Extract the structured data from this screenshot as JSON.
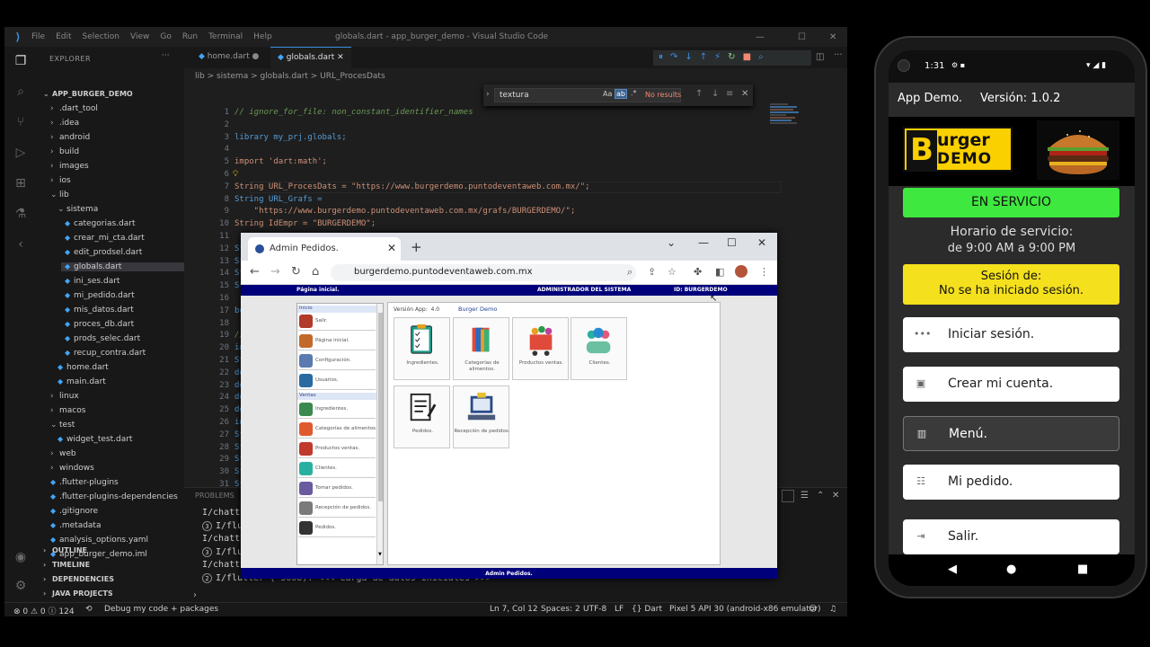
{
  "vscode": {
    "menu": [
      "File",
      "Edit",
      "Selection",
      "View",
      "Go",
      "Run",
      "Terminal",
      "Help"
    ],
    "title": "globals.dart - app_burger_demo - Visual Studio Code",
    "explorer_label": "EXPLORER",
    "tree": [
      {
        "label": "APP_BURGER_DEMO",
        "type": "root"
      },
      {
        "label": ".dart_tool",
        "type": "folder"
      },
      {
        "label": ".idea",
        "type": "folder"
      },
      {
        "label": "android",
        "type": "folder"
      },
      {
        "label": "build",
        "type": "folder"
      },
      {
        "label": "images",
        "type": "folder"
      },
      {
        "label": "ios",
        "type": "folder"
      },
      {
        "label": "lib",
        "type": "folder-open"
      },
      {
        "label": "sistema",
        "type": "folder-open"
      },
      {
        "label": "categorias.dart",
        "type": "file"
      },
      {
        "label": "crear_mi_cta.dart",
        "type": "file"
      },
      {
        "label": "edit_prodsel.dart",
        "type": "file"
      },
      {
        "label": "globals.dart",
        "type": "file"
      },
      {
        "label": "ini_ses.dart",
        "type": "file"
      },
      {
        "label": "mi_pedido.dart",
        "type": "file"
      },
      {
        "label": "mis_datos.dart",
        "type": "file"
      },
      {
        "label": "proces_db.dart",
        "type": "file"
      },
      {
        "label": "prods_selec.dart",
        "type": "file"
      },
      {
        "label": "recup_contra.dart",
        "type": "file"
      },
      {
        "label": "home.dart",
        "type": "file"
      },
      {
        "label": "main.dart",
        "type": "file"
      },
      {
        "label": "linux",
        "type": "folder"
      },
      {
        "label": "macos",
        "type": "folder"
      },
      {
        "label": "test",
        "type": "folder-open"
      },
      {
        "label": "widget_test.dart",
        "type": "file"
      },
      {
        "label": "web",
        "type": "folder"
      },
      {
        "label": "windows",
        "type": "folder"
      },
      {
        "label": ".flutter-plugins",
        "type": "file"
      },
      {
        "label": ".flutter-plugins-dependencies",
        "type": "file"
      },
      {
        "label": ".gitignore",
        "type": "file"
      },
      {
        "label": ".metadata",
        "type": "file"
      },
      {
        "label": "analysis_options.yaml",
        "type": "file"
      },
      {
        "label": "app_burger_demo.iml",
        "type": "file"
      }
    ],
    "sections": [
      "OUTLINE",
      "TIMELINE",
      "DEPENDENCIES",
      "JAVA PROJECTS"
    ],
    "tabs": [
      "home.dart",
      "globals.dart"
    ],
    "breadcrumb": "lib  >  sistema  >  globals.dart  >  URL_ProcesDats",
    "find": {
      "value": "textura",
      "aa": "Aa",
      "ab": "ab",
      "re": ".*",
      "no_results": "No results"
    },
    "code": [
      {
        "n": "1",
        "t": "// ignore_for_file: non_constant_identifier_names"
      },
      {
        "n": "2",
        "t": ""
      },
      {
        "n": "3",
        "t": "library my_prj.globals;"
      },
      {
        "n": "4",
        "t": ""
      },
      {
        "n": "5",
        "t": "import 'dart:math';"
      },
      {
        "n": "6",
        "t": ""
      },
      {
        "n": "7",
        "t": "String URL_ProcesDats = \"https://www.burgerdemo.puntodeventaweb.com.mx/\";"
      },
      {
        "n": "8",
        "t": "String URL_Grafs ="
      },
      {
        "n": "9",
        "t": "    \"https://www.burgerdemo.puntodeventaweb.com.mx/grafs/BURGERDEMO/\";"
      },
      {
        "n": "10",
        "t": "String IdEmpr = \"BURGERDEMO\";"
      },
      {
        "n": "11",
        "t": ""
      },
      {
        "n": "12",
        "t": "Str"
      },
      {
        "n": "13",
        "t": "Str"
      },
      {
        "n": "14",
        "t": "Str"
      },
      {
        "n": "15",
        "t": "Str"
      },
      {
        "n": "16",
        "t": ""
      },
      {
        "n": "17",
        "t": "boo"
      },
      {
        "n": "18",
        "t": ""
      },
      {
        "n": "19",
        "t": "//"
      },
      {
        "n": "20",
        "t": "int"
      },
      {
        "n": "21",
        "t": "Str"
      },
      {
        "n": "22",
        "t": "dou"
      },
      {
        "n": "23",
        "t": "dou"
      },
      {
        "n": "24",
        "t": "dou"
      },
      {
        "n": "25",
        "t": "dou"
      },
      {
        "n": "26",
        "t": "int"
      },
      {
        "n": "27",
        "t": "Str"
      },
      {
        "n": "28",
        "t": "Str"
      },
      {
        "n": "29",
        "t": "Str"
      },
      {
        "n": "30",
        "t": "Str"
      },
      {
        "n": "31",
        "t": "Str"
      }
    ],
    "panel_tab": "PROBLEMS",
    "terminal": [
      {
        "badge": "",
        "text": "I/chatty"
      },
      {
        "badge": "3",
        "text": "I/flut"
      },
      {
        "badge": "",
        "text": "I/chatty"
      },
      {
        "badge": "3",
        "text": "I/flut"
      },
      {
        "badge": "",
        "text": "I/chatty"
      },
      {
        "badge": "2",
        "text": "I/flutter ( 5008): <<< Carga de datos iniciales >>>"
      }
    ],
    "status": {
      "errors": "⊗ 0 ⚠ 0 ⓘ 124",
      "debug": "Debug my code + packages",
      "pos": "Ln 7, Col 12",
      "spaces": "Spaces: 2",
      "enc": "UTF-8",
      "eol": "LF",
      "lang": "{} Dart",
      "device": "Pixel 5 API 30 (android-x86 emulator)"
    }
  },
  "browser": {
    "tab_title": "Admin Pedidos.",
    "url": "burgerdemo.puntodeventaweb.com.mx",
    "site": {
      "header_left": "Página inicial.",
      "header_mid": "ADMINISTRADOR DEL SISTEMA",
      "header_right": "ID:  BURGERDEMO",
      "version_label": "Versión App:",
      "version": "4.0",
      "brand": "Burger Demo",
      "footer": "Admin Pedidos.",
      "menu_group1": "Inicio",
      "menu_group2": "Ventas",
      "menu1": [
        "Salir.",
        "Página inicial.",
        "Configuración.",
        "Usuarios."
      ],
      "menu2": [
        "Ingredientes.",
        "Categorías de alimentos.",
        "Productos ventas.",
        "Clientes.",
        "Tomar pedidos.",
        "Recepción de pedidos.",
        "Pedidos."
      ],
      "cards": [
        "Ingredientes.",
        "Categorías de alimentos.",
        "Productos ventas.",
        "Clientes.",
        "Pedidos.",
        "Recepción de pedidos."
      ]
    }
  },
  "phone": {
    "time": "1:31",
    "app_title": "App Demo.",
    "version": "Versión: 1.0.2",
    "logo_line1": "urger",
    "logo_line2": "DEMO",
    "logo_b": "B",
    "status_btn": "EN SERVICIO",
    "schedule_line1": "Horario de servicio:",
    "schedule_line2": "de 9:00 AM a 9:00 PM",
    "session_line1": "Sesión de:",
    "session_line2": "No se ha iniciado sesión.",
    "actions": [
      "Iniciar sesión.",
      "Crear mi cuenta.",
      "Menú.",
      "Mi pedido.",
      "Salir."
    ],
    "colors": {
      "green": "#3ee83e",
      "yellow": "#f4e01c",
      "logo": "#fbd000"
    }
  }
}
